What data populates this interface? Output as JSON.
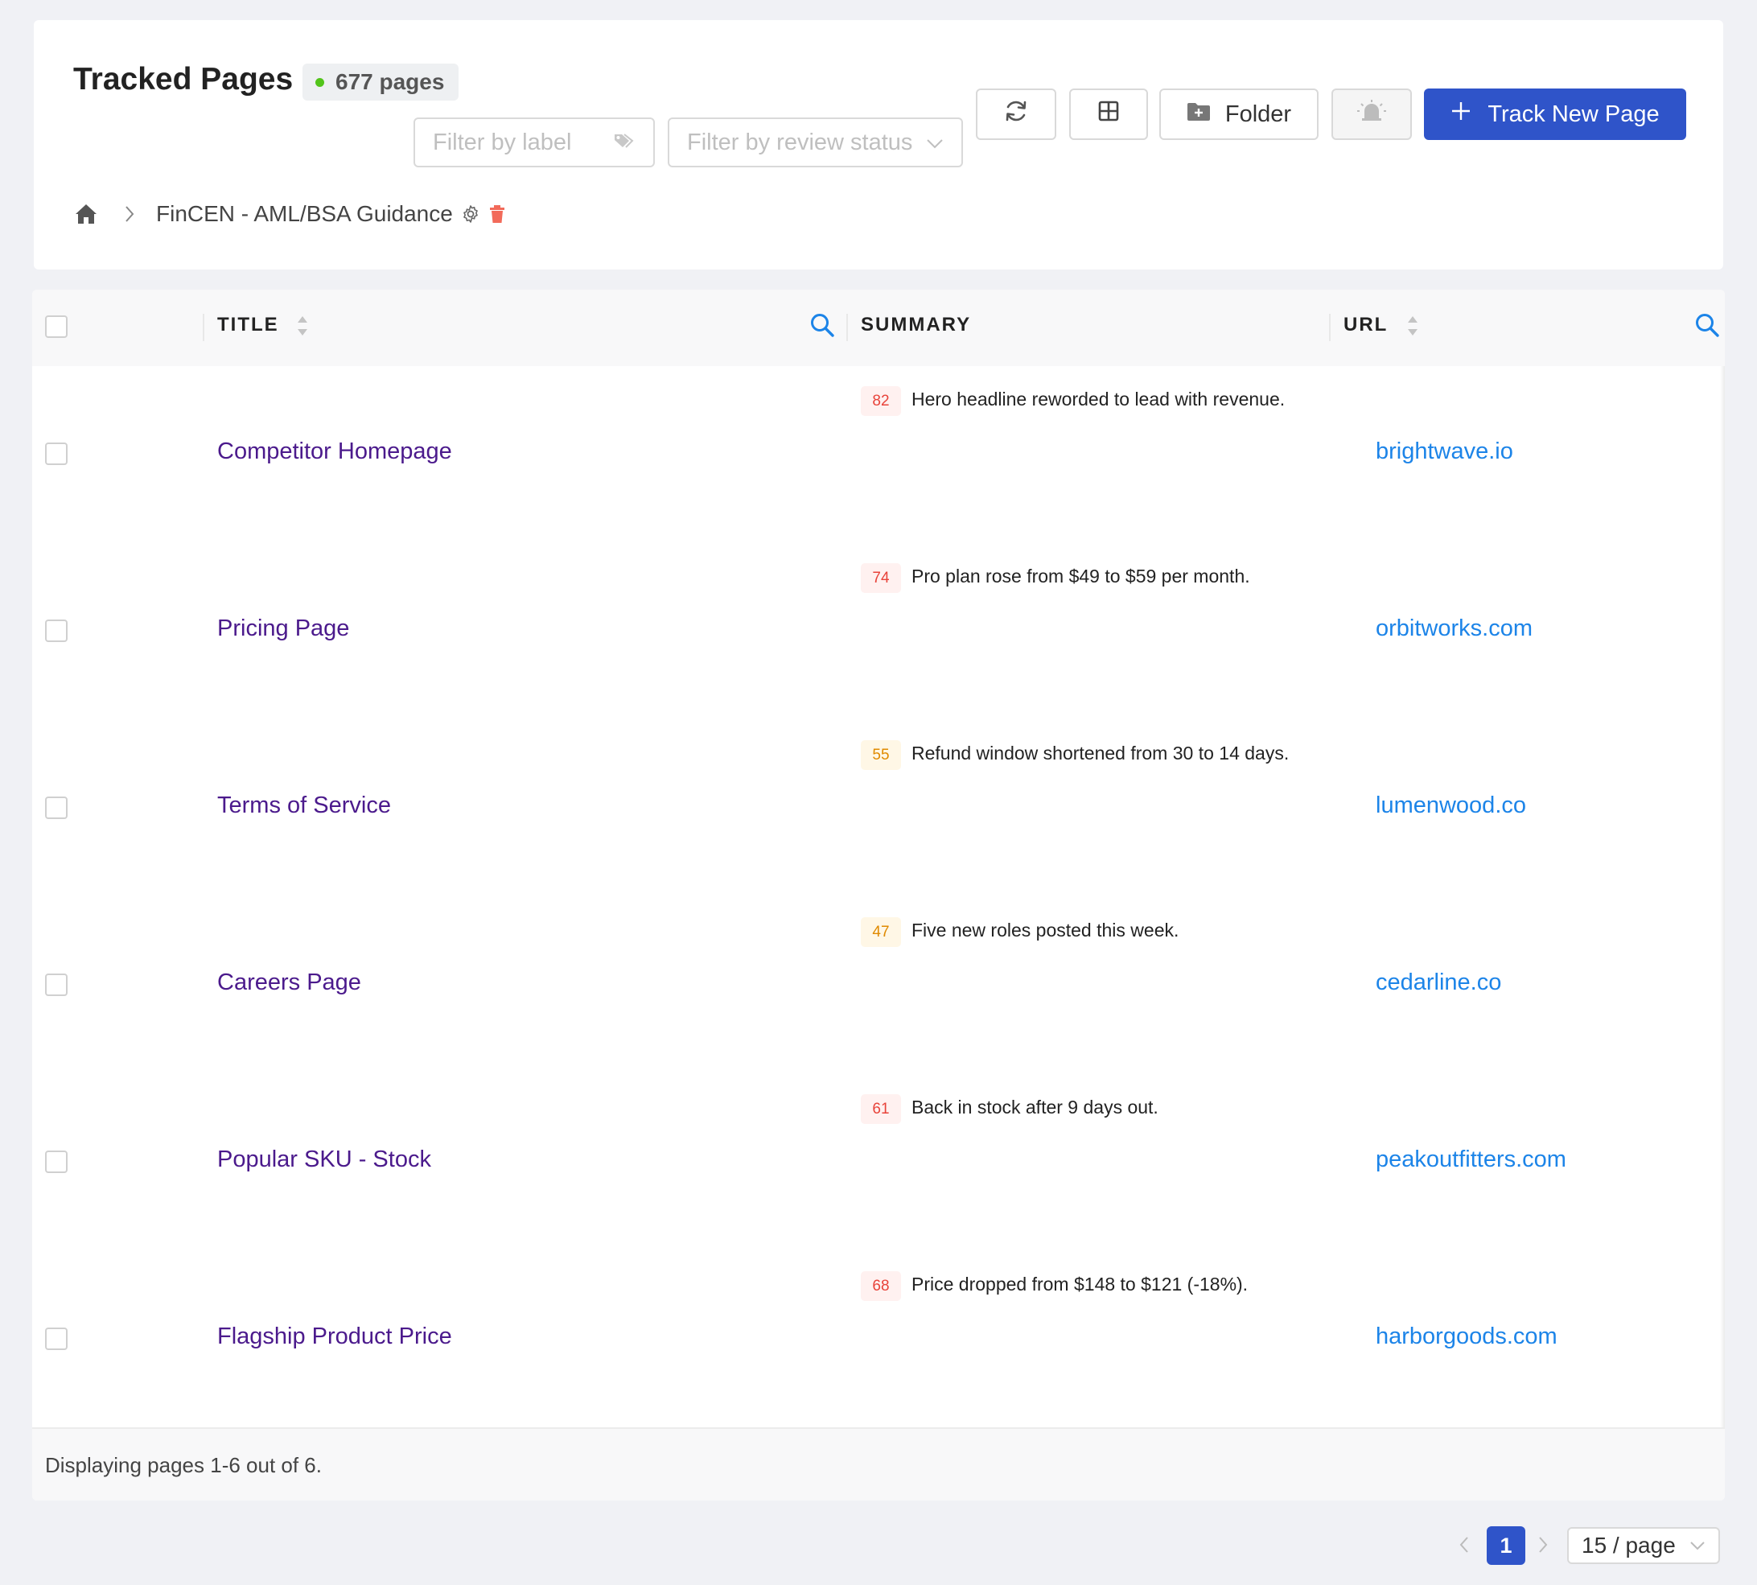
{
  "header": {
    "title": "Tracked Pages",
    "count_label": "677 pages",
    "filter_label_placeholder": "Filter by label",
    "filter_status_placeholder": "Filter by review status",
    "folder_label": "Folder",
    "track_label": "Track New Page",
    "status_color": "#52c41a",
    "accent_color": "#2f54c9"
  },
  "breadcrumb": {
    "home_icon": "home-icon",
    "current": "FinCEN - AML/BSA Guidance"
  },
  "table": {
    "columns": {
      "title": "TITLE",
      "summary": "SUMMARY",
      "url": "URL"
    },
    "rows": [
      {
        "title": "Competitor Homepage",
        "score": "82",
        "score_level": "red",
        "summary": "Hero headline reworded to lead with revenue.",
        "url": "brightwave.io"
      },
      {
        "title": "Pricing Page",
        "score": "74",
        "score_level": "red",
        "summary": "Pro plan rose from $49 to $59 per month.",
        "url": "orbitworks.com"
      },
      {
        "title": "Terms of Service",
        "score": "55",
        "score_level": "orange",
        "summary": "Refund window shortened from 30 to 14 days.",
        "url": "lumenwood.co"
      },
      {
        "title": "Careers Page",
        "score": "47",
        "score_level": "orange",
        "summary": "Five new roles posted this week.",
        "url": "cedarline.co"
      },
      {
        "title": "Popular SKU - Stock",
        "score": "61",
        "score_level": "red",
        "summary": "Back in stock after 9 days out.",
        "url": "peakoutfitters.com"
      },
      {
        "title": "Flagship Product Price",
        "score": "68",
        "score_level": "red",
        "summary": "Price dropped from $148 to $121 (-18%).",
        "url": "harborgoods.com"
      }
    ],
    "footer": "Displaying pages 1-6 out of 6."
  },
  "pagination": {
    "current_page": "1",
    "page_size": "15 / page"
  }
}
